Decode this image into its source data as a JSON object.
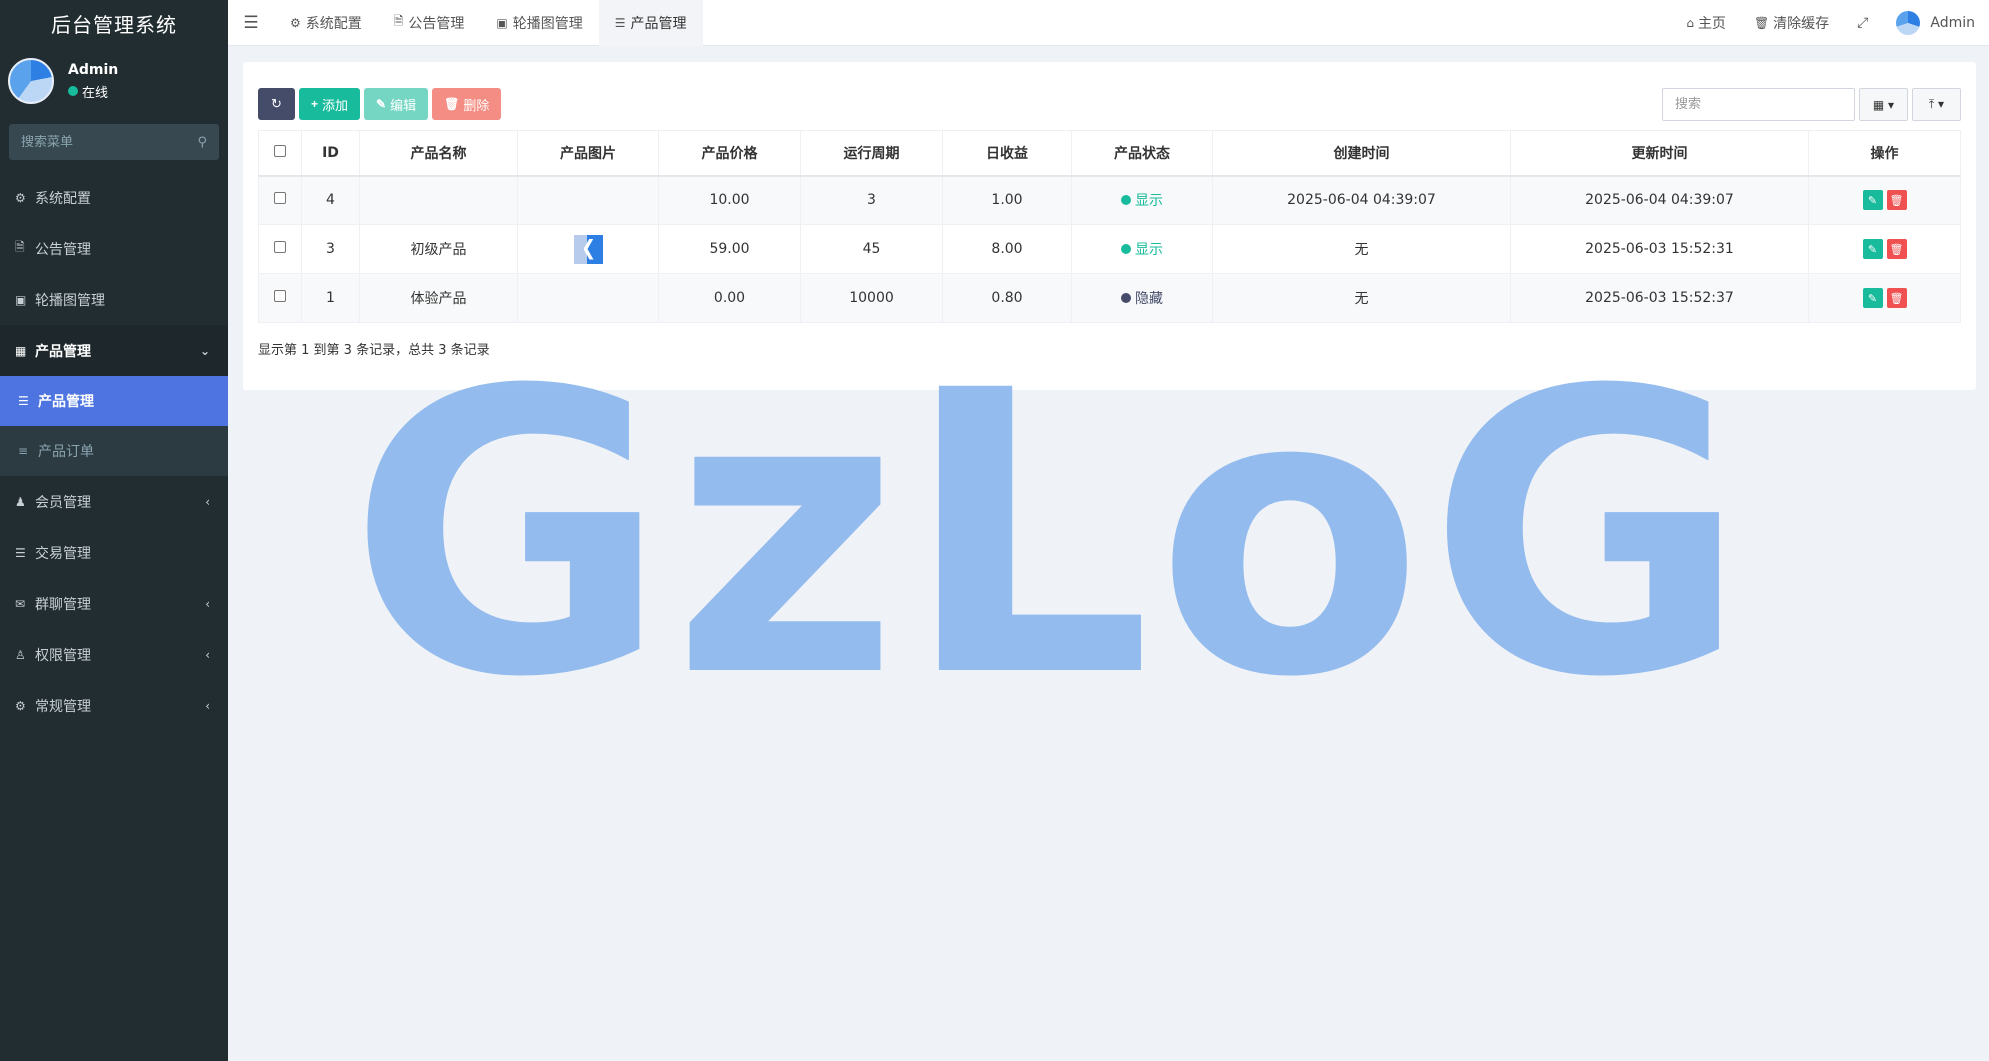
{
  "sidebar": {
    "brand": "后台管理系统",
    "user": {
      "name": "Admin",
      "status": "在线",
      "status_color": "#18bc9c"
    },
    "search_placeholder": "搜索菜单",
    "items": [
      {
        "label": "系统配置",
        "icon": "gear-icon"
      },
      {
        "label": "公告管理",
        "icon": "file-icon"
      },
      {
        "label": "轮播图管理",
        "icon": "image-icon"
      },
      {
        "label": "产品管理",
        "icon": "grid-icon"
      },
      {
        "label": "会员管理",
        "icon": "user-icon"
      },
      {
        "label": "交易管理",
        "icon": "list-icon"
      },
      {
        "label": "群聊管理",
        "icon": "chat-icon"
      },
      {
        "label": "权限管理",
        "icon": "users-icon"
      },
      {
        "label": "常规管理",
        "icon": "cogs-icon"
      }
    ],
    "submenu": [
      {
        "label": "产品管理",
        "icon": "list-icon"
      },
      {
        "label": "产品订单",
        "icon": "list-icon"
      }
    ]
  },
  "topbar": {
    "tabs": [
      {
        "label": "系统配置",
        "icon": "gear-icon"
      },
      {
        "label": "公告管理",
        "icon": "file-icon"
      },
      {
        "label": "轮播图管理",
        "icon": "image-icon"
      },
      {
        "label": "产品管理",
        "icon": "list-icon"
      }
    ],
    "home": "主页",
    "clear_cache": "清除缓存",
    "admin": "Admin"
  },
  "toolbar": {
    "add": "添加",
    "edit": "编辑",
    "delete": "删除",
    "search_placeholder": "搜索"
  },
  "table": {
    "headers": [
      "ID",
      "产品名称",
      "产品图片",
      "产品价格",
      "运行周期",
      "日收益",
      "产品状态",
      "创建时间",
      "更新时间",
      "操作"
    ],
    "rows": [
      {
        "id": "4",
        "name": "",
        "has_image": false,
        "price": "10.00",
        "cycle": "3",
        "daily": "1.00",
        "status": "显示",
        "status_color": "#18bc9c",
        "created": "2025-06-04 04:39:07",
        "updated": "2025-06-04 04:39:07"
      },
      {
        "id": "3",
        "name": "初级产品",
        "has_image": true,
        "price": "59.00",
        "cycle": "45",
        "daily": "8.00",
        "status": "显示",
        "status_color": "#18bc9c",
        "created": "无",
        "updated": "2025-06-03 15:52:31"
      },
      {
        "id": "1",
        "name": "体验产品",
        "has_image": false,
        "price": "0.00",
        "cycle": "10000",
        "daily": "0.80",
        "status": "隐藏",
        "status_color": "#444c69",
        "created": "无",
        "updated": "2025-06-03 15:52:37"
      }
    ],
    "footer": "显示第 1 到第 3 条记录，总共 3 条记录"
  },
  "watermark": "GzLoG"
}
